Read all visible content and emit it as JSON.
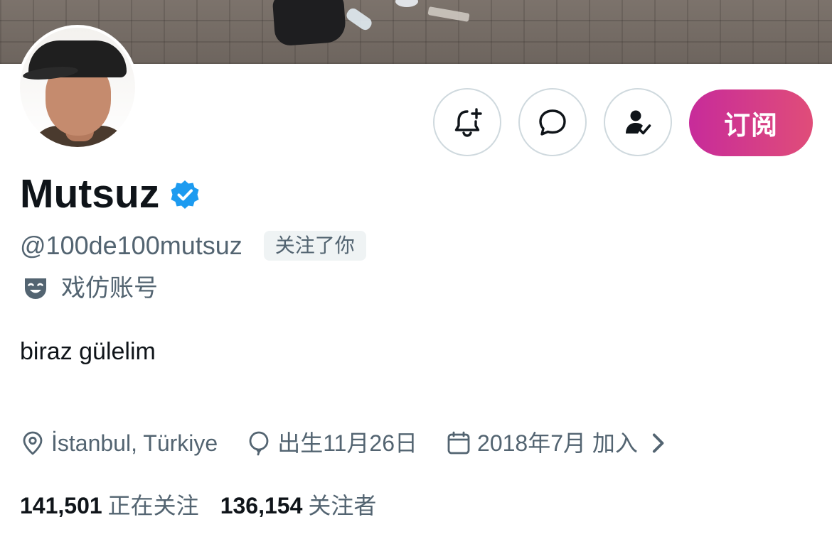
{
  "profile": {
    "display_name": "Mutsuz",
    "handle": "@100de100mutsuz",
    "follows_you_badge": "关注了你",
    "parody_label": "戏仿账号",
    "bio": "biraz gülelim",
    "location": "İstanbul, Türkiye",
    "birthday": "出生11月26日",
    "joined": "2018年7月 加入",
    "following_count": "141,501",
    "following_label": "正在关注",
    "followers_count": "136,154",
    "followers_label": "关注者"
  },
  "actions": {
    "subscribe_label": "订阅"
  },
  "icons": {
    "notifications": "bell-plus-icon",
    "message": "message-bubble-icon",
    "follow_state": "person-check-icon",
    "verified": "verified-badge-icon",
    "parody": "theater-mask-icon",
    "location": "location-pin-icon",
    "birthday": "balloon-icon",
    "joined": "calendar-icon",
    "more": "chevron-right-icon"
  },
  "colors": {
    "verified_blue": "#1d9bf0",
    "subscribe_gradient_start": "#c72b9a",
    "subscribe_gradient_end": "#e04d79",
    "secondary_text": "#536471",
    "primary_text": "#0f1419",
    "badge_background": "#eff3f4"
  }
}
